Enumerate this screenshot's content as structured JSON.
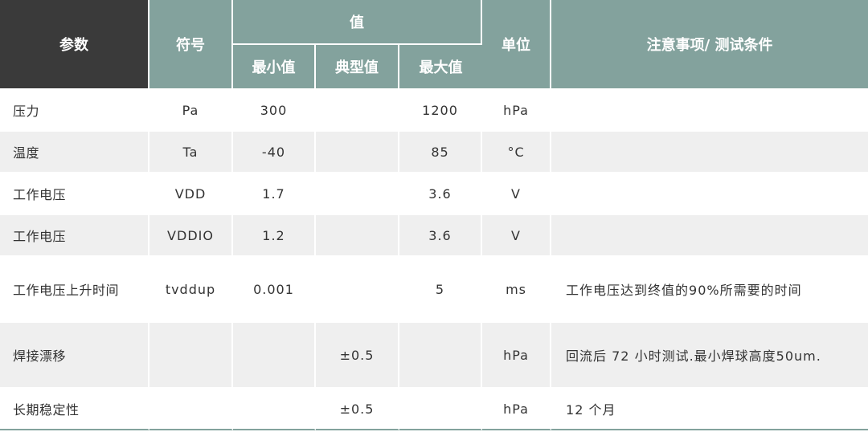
{
  "header": {
    "param": "参数",
    "symbol": "符号",
    "value": "值",
    "min": "最小值",
    "typ": "典型值",
    "max": "最大值",
    "unit": "单位",
    "notes": "注意事项/ 测试条件"
  },
  "rows": [
    {
      "param": "压力",
      "symbol": "Pa",
      "min": "300",
      "typ": "",
      "max": "1200",
      "unit": "hPa",
      "notes": ""
    },
    {
      "param": "温度",
      "symbol": "Ta",
      "min": "-40",
      "typ": "",
      "max": "85",
      "unit": "°C",
      "notes": ""
    },
    {
      "param": "工作电压",
      "symbol": "VDD",
      "min": "1.7",
      "typ": "",
      "max": "3.6",
      "unit": "V",
      "notes": ""
    },
    {
      "param": "工作电压",
      "symbol": "VDDIO",
      "min": "1.2",
      "typ": "",
      "max": "3.6",
      "unit": "V",
      "notes": ""
    },
    {
      "param": "工作电压上升时间",
      "symbol": "tvddup",
      "min": "0.001",
      "typ": "",
      "max": "5",
      "unit": "ms",
      "notes": "工作电压达到终值的90%所需要的时间"
    },
    {
      "param": "焊接漂移",
      "symbol": "",
      "min": "",
      "typ": "±0.5",
      "max": "",
      "unit": "hPa",
      "notes": "回流后 72 小时测试.最小焊球高度50um."
    },
    {
      "param": "长期稳定性",
      "symbol": "",
      "min": "",
      "typ": "±0.5",
      "max": "",
      "unit": "hPa",
      "notes": "12 个月"
    }
  ]
}
